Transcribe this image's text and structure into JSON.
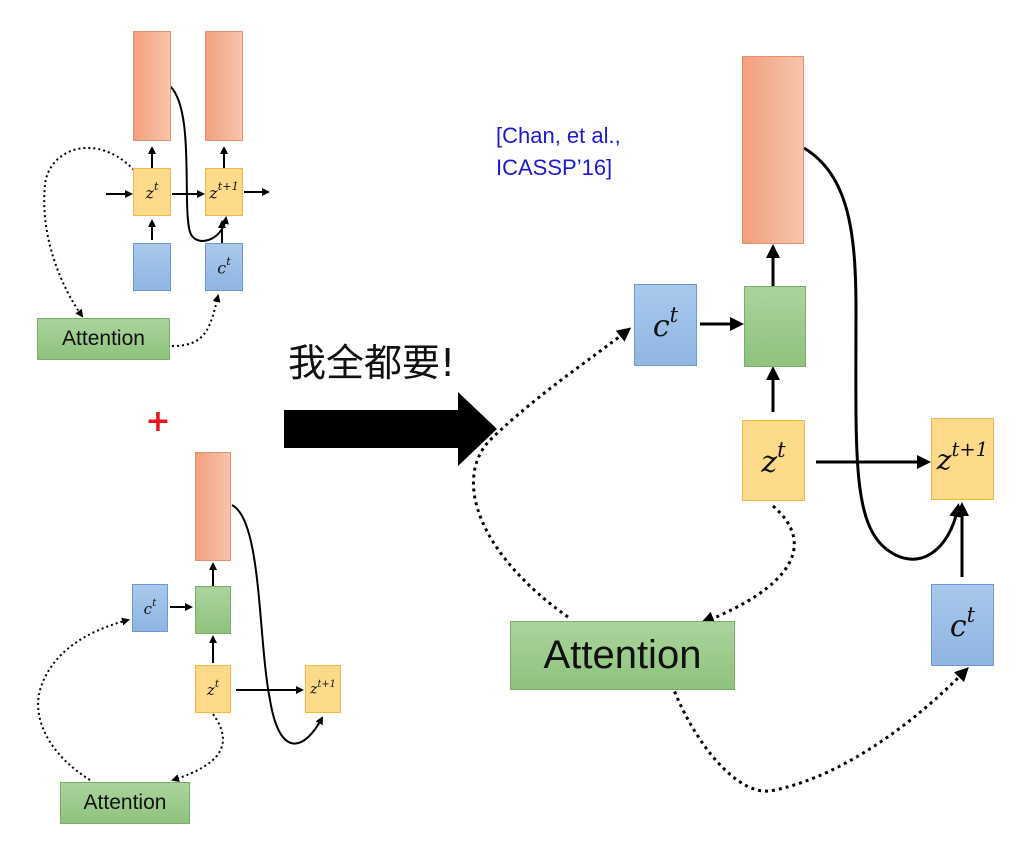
{
  "citation": {
    "line1": "[Chan, et al.,",
    "line2": "ICASSP’16]"
  },
  "main_label": "我全都要!",
  "plus_sign": "+",
  "colors": {
    "citation_blue": "#1a1ad6",
    "plus_red": "#e8141b",
    "output_orange": "#f2a07f",
    "state_yellow": "#fdd98a",
    "context_blue": "#9dbfe8",
    "attention_green": "#9dcb8a"
  },
  "top_diagram": {
    "z_t": {
      "base": "z",
      "sup": "t"
    },
    "z_t1": {
      "base": "z",
      "sup": "t+1"
    },
    "c_t": {
      "base": "c",
      "sup": "t"
    },
    "attention": "Attention"
  },
  "bottom_diagram": {
    "c_t": {
      "base": "c",
      "sup": "t"
    },
    "z_t": {
      "base": "z",
      "sup": "t"
    },
    "z_t1": {
      "base": "z",
      "sup": "t+1"
    },
    "attention": "Attention"
  },
  "right_diagram": {
    "c_t_left": {
      "base": "c",
      "sup": "t"
    },
    "z_t": {
      "base": "z",
      "sup": "t"
    },
    "z_t1": {
      "base": "z",
      "sup": "t+1"
    },
    "c_t_right": {
      "base": "c",
      "sup": "t"
    },
    "attention": "Attention"
  }
}
